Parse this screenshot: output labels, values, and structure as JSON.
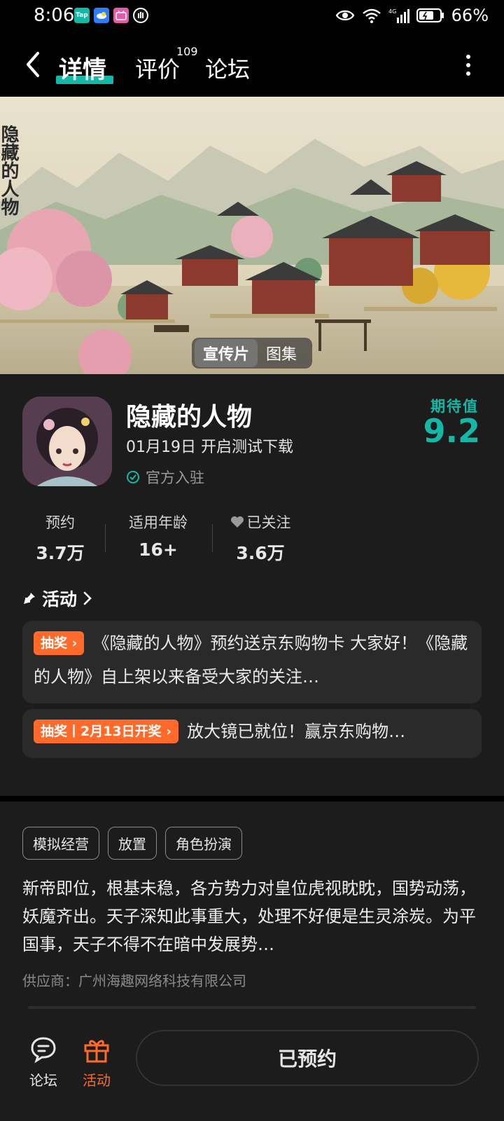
{
  "status_bar": {
    "time": "8:06",
    "apps": [
      {
        "icon": "taptap-app-icon",
        "label": "Tap",
        "color": "#14b8a6"
      },
      {
        "icon": "weather-app-icon",
        "label": "",
        "color": "#2b7fff"
      },
      {
        "icon": "bilibili-app-icon",
        "label": "",
        "color": "#e859a7"
      },
      {
        "icon": "shield-app-icon",
        "label": "",
        "color": "#555555"
      }
    ],
    "network": "4G",
    "battery": "66%"
  },
  "header": {
    "tabs": [
      {
        "label": "详情",
        "active": true
      },
      {
        "label": "评价",
        "badge": "109"
      },
      {
        "label": "论坛"
      }
    ]
  },
  "banner": {
    "title_art": "隐藏的人物",
    "media_options": [
      "宣传片",
      "图集"
    ],
    "selected": "宣传片"
  },
  "game": {
    "name": "隐藏的人物",
    "release": "01月19日 开启测试下载",
    "official": "官方入驻",
    "expect_label": "期待值",
    "expect_value": "9.2"
  },
  "stats": [
    {
      "label": "预约",
      "value": "3.7万"
    },
    {
      "label": "适用年龄",
      "value": "16+"
    },
    {
      "label": "已关注",
      "value": "3.6万"
    }
  ],
  "activity": {
    "title": "活动",
    "items": [
      {
        "tag": "抽奖 ›",
        "text": "《隐藏的人物》预约送京东购物卡 大家好！《隐藏的人物》自上架以来备受大家的关注…"
      },
      {
        "tag": "抽奖丨2月13日开奖 ›",
        "text": "放大镜已就位！赢京东购物…"
      }
    ]
  },
  "description": {
    "tags": [
      "模拟经营",
      "放置",
      "角色扮演"
    ],
    "text": "新帝即位，根基未稳，各方势力对皇位虎视眈眈，国势动荡，妖魔齐出。天子深知此事重大，处理不好便是生灵涂炭。为平国事，天子不得不在暗中发展势…",
    "supplier": "供应商：广州海趣网络科技有限公司"
  },
  "bottom_bar": {
    "forum_label": "论坛",
    "activity_label": "活动",
    "reserve_label": "已预约"
  },
  "colors": {
    "accent": "#14b8a6",
    "orange": "#ff6a2b",
    "panel": "#1c1c1c"
  }
}
